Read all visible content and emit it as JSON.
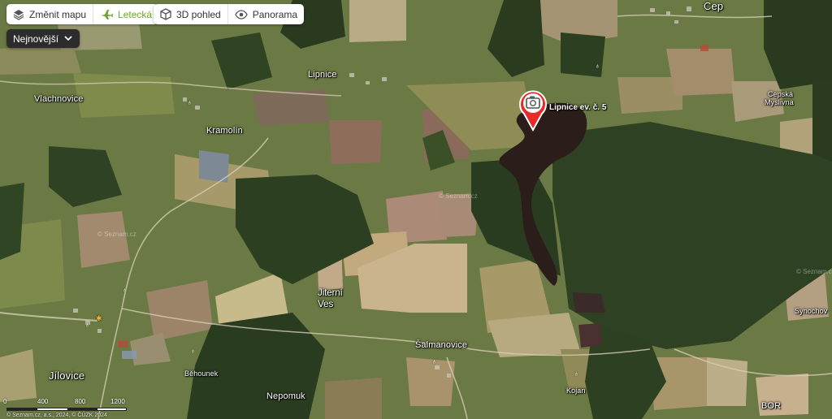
{
  "toolbar_left": {
    "change_map": "Změnit mapu",
    "aerial": "Letecká"
  },
  "toolbar_right": {
    "view3d": "3D pohled",
    "panorama": "Panorama"
  },
  "filter": {
    "label": "Nejnovější"
  },
  "places": {
    "cep": "Cep",
    "lipnice": "Lipnice",
    "vlachnovice": "Vlachnovice",
    "kramolin": "Kramolín",
    "cepska_myslivna_1": "Cepská",
    "cepska_myslivna_2": "Myslivna",
    "jiterni_ves_1": "Jiterní",
    "jiterni_ves_2": "Ves",
    "synochov": "Synochov",
    "salmanovice": "Šalmanovice",
    "jilovice": "Jílovice",
    "behounek": "Běhounek",
    "nepomuk": "Nepomuk",
    "kojan": "Kojan",
    "bor": "BOR"
  },
  "marker": {
    "label": "Lipnice ev. č. 5",
    "icon": "camera-icon",
    "color": "#e8292a"
  },
  "scale": {
    "ticks": [
      "0",
      "400",
      "800",
      "1200"
    ],
    "unit": "m"
  },
  "copyright": "© Seznam.cz, a.s., 2024, © ČÚZK 2024",
  "watermark": "© Seznam.cz",
  "colors": {
    "accent": "#69a826",
    "marker": "#e8292a",
    "water": "#2b1d1a"
  }
}
